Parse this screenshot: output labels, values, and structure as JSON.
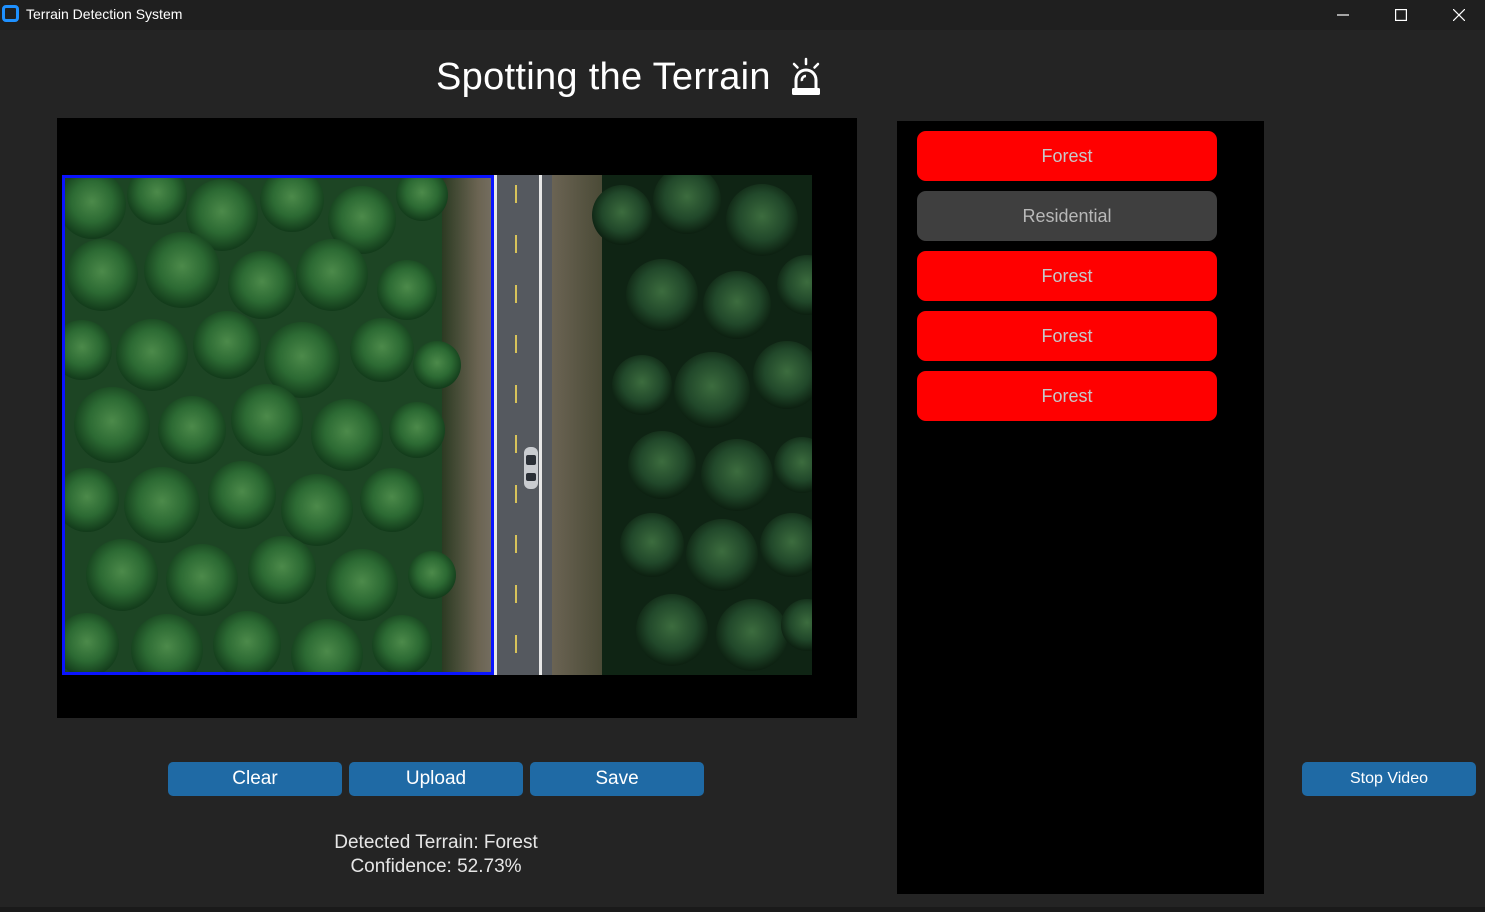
{
  "window": {
    "title": "Terrain Detection System",
    "controls": {
      "minimize": "—",
      "maximize": "☐",
      "close": "✕"
    }
  },
  "header": {
    "title": "Spotting the Terrain",
    "icon": "alarm-siren-icon"
  },
  "video": {
    "scene": "aerial forest road",
    "detection_box_color": "#0a14ff"
  },
  "results": {
    "items": [
      {
        "label": "Forest",
        "status": "active",
        "color": "#ff0000"
      },
      {
        "label": "Residential",
        "status": "inactive",
        "color": "#3f3f3f"
      },
      {
        "label": "Forest",
        "status": "active",
        "color": "#ff0000"
      },
      {
        "label": "Forest",
        "status": "active",
        "color": "#ff0000"
      },
      {
        "label": "Forest",
        "status": "active",
        "color": "#ff0000"
      }
    ]
  },
  "toolbar": {
    "clear_label": "Clear",
    "upload_label": "Upload",
    "save_label": "Save",
    "stop_label": "Stop Video",
    "accent": "#1f6aa5"
  },
  "status": {
    "terrain_text": "Detected Terrain: Forest",
    "confidence_text": "Confidence: 52.73%"
  }
}
